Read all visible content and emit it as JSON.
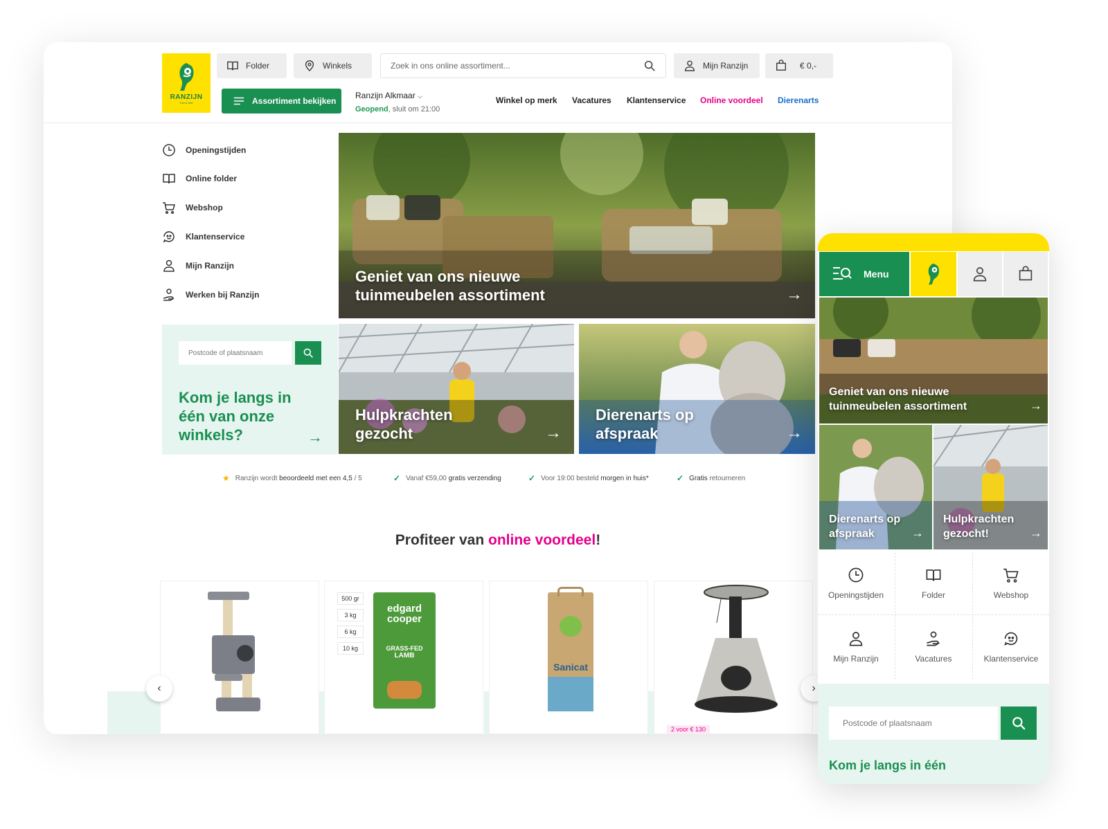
{
  "brand": {
    "name": "RANZIJN",
    "tagline": "Tuin & Dier",
    "colors": {
      "yellow": "#ffe100",
      "green": "#1a8f52",
      "pink": "#e6008a",
      "mint": "#e6f5ef",
      "blue": "#1a6fc4"
    }
  },
  "header": {
    "folder_label": "Folder",
    "winkels_label": "Winkels",
    "search_placeholder": "Zoek in ons online assortiment...",
    "account_label": "Mijn Ranzijn",
    "cart_total": "€ 0,-",
    "assortment_button": "Assortiment bekijken",
    "store_name": "Ranzijn Alkmaar",
    "store_status_open": "Geopend",
    "store_status_rest": ", sluit om 21:00",
    "nav": [
      {
        "label": "Winkel op merk"
      },
      {
        "label": "Vacatures"
      },
      {
        "label": "Klantenservice"
      },
      {
        "label": "Online voordeel"
      },
      {
        "label": "Dierenarts"
      }
    ]
  },
  "sidebar": {
    "items": [
      {
        "label": "Openingstijden",
        "icon": "clock-icon"
      },
      {
        "label": "Online folder",
        "icon": "book-icon"
      },
      {
        "label": "Webshop",
        "icon": "cart-icon"
      },
      {
        "label": "Klantenservice",
        "icon": "support-icon"
      },
      {
        "label": "Mijn Ranzijn",
        "icon": "user-icon"
      },
      {
        "label": "Werken bij Ranzijn",
        "icon": "hand-icon"
      }
    ]
  },
  "store_finder": {
    "placeholder": "Postcode of plaatsnaam",
    "title": "Kom je langs in één van onze winkels?"
  },
  "banners": {
    "main": "Geniet van ons nieuwe tuinmeubelen assortiment",
    "helpers": "Hulpkrachten gezocht",
    "vet": "Dierenarts op afspraak"
  },
  "usps": {
    "rating_prefix": "Ranzijn wordt",
    "rating_bold": "beoordeeld met een 4,5",
    "rating_suffix": "/ 5",
    "shipping_prefix": "Vanaf €59,00",
    "shipping_bold": "gratis verzending",
    "delivery_prefix": "Voor 19:00 besteld",
    "delivery_bold": "morgen in huis*",
    "returns_bold": "Gratis",
    "returns_suffix": "retourneren"
  },
  "promo": {
    "prefix": "Profiteer van ",
    "highlight": "online voordeel",
    "suffix": "!"
  },
  "products": {
    "sizes": [
      "500 gr",
      "3 kg",
      "6 kg",
      "10 kg"
    ],
    "bag_brand": "edgard cooper",
    "bag_line1": "GRASS-FED",
    "bag_line2": "LAMB",
    "litter_brand": "Sanicat",
    "deal_badge": "2 voor € 130"
  },
  "mobile": {
    "menu_label": "Menu",
    "banner_main": "Geniet van ons nieuwe tuinmeubelen assortiment",
    "banner_vet": "Dierenarts op afspraak",
    "banner_helpers": "Hulpkrachten gezocht!",
    "grid": [
      {
        "label": "Openingstijden",
        "icon": "clock-icon"
      },
      {
        "label": "Folder",
        "icon": "book-icon"
      },
      {
        "label": "Webshop",
        "icon": "cart-icon"
      },
      {
        "label": "Mijn Ranzijn",
        "icon": "user-icon"
      },
      {
        "label": "Vacatures",
        "icon": "hand-icon"
      },
      {
        "label": "Klantenservice",
        "icon": "support-icon"
      }
    ],
    "postcode_placeholder": "Postcode of plaatsnaam",
    "finder_title": "Kom je langs in één"
  }
}
